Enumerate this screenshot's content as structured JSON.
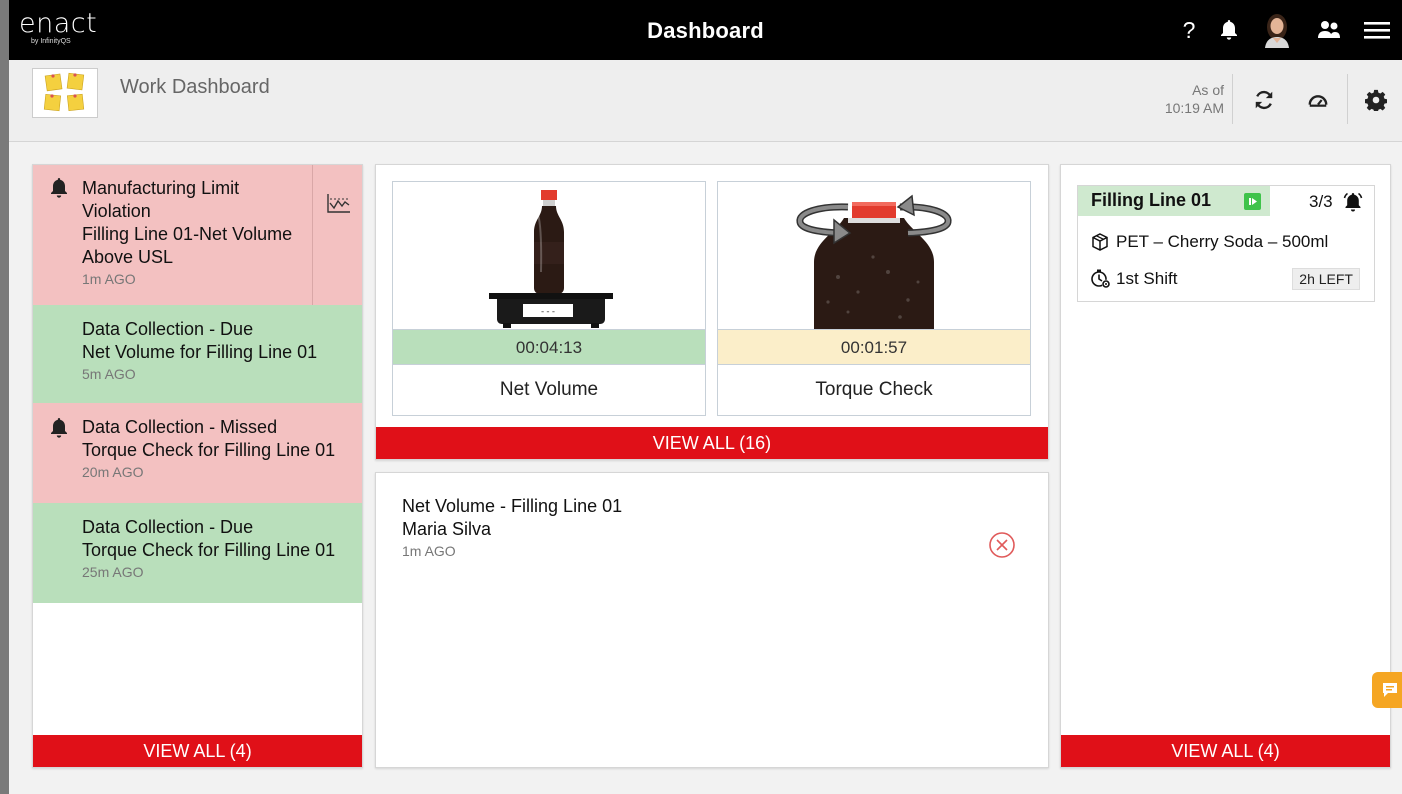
{
  "header": {
    "logo_text": "enact",
    "logo_sub": "by InfinityQS",
    "title": "Dashboard",
    "help_label": "?"
  },
  "subheader": {
    "title": "Work Dashboard",
    "as_of_label": "As of",
    "as_of_time": "10:19 AM"
  },
  "notifications": {
    "items": [
      {
        "line1": "Manufacturing Limit Violation",
        "line2": "Filling Line 01-Net Volume Above USL",
        "time": "1m AGO",
        "status": "red",
        "has_bell": true,
        "has_chart": true
      },
      {
        "line1": "Data Collection - Due",
        "line2": "Net Volume for Filling Line 01",
        "time": "5m AGO",
        "status": "green",
        "has_bell": false
      },
      {
        "line1": "Data Collection - Missed",
        "line2": "Torque Check for Filling Line 01",
        "time": "20m AGO",
        "status": "red",
        "has_bell": true
      },
      {
        "line1": "Data Collection - Due",
        "line2": "Torque Check for Filling Line 01",
        "time": "25m AGO",
        "status": "green",
        "has_bell": false
      }
    ],
    "view_all": "VIEW ALL  (4)"
  },
  "tasks": {
    "cards": [
      {
        "timer": "00:04:13",
        "name": "Net Volume",
        "timer_color": "#b9dfbb"
      },
      {
        "timer": "00:01:57",
        "name": "Torque Check",
        "timer_color": "#fbeec9"
      }
    ],
    "view_all": "VIEW ALL  (16)"
  },
  "recent": {
    "title": "Net Volume - Filling Line 01",
    "user": "Maria Silva",
    "time": "1m AGO"
  },
  "lines": {
    "card": {
      "title": "Filling Line 01",
      "count": "3/3",
      "product": "PET – Cherry Soda – 500ml",
      "shift": "1st Shift",
      "time_left": "2h LEFT"
    },
    "view_all": "VIEW ALL  (4)"
  },
  "colors": {
    "accent_red": "#e01018",
    "alert_red_bg": "#f3c1c1",
    "ok_green_bg": "#b9dfbb",
    "warn_yellow_bg": "#fbeec9",
    "chat_orange": "#f5a623"
  }
}
